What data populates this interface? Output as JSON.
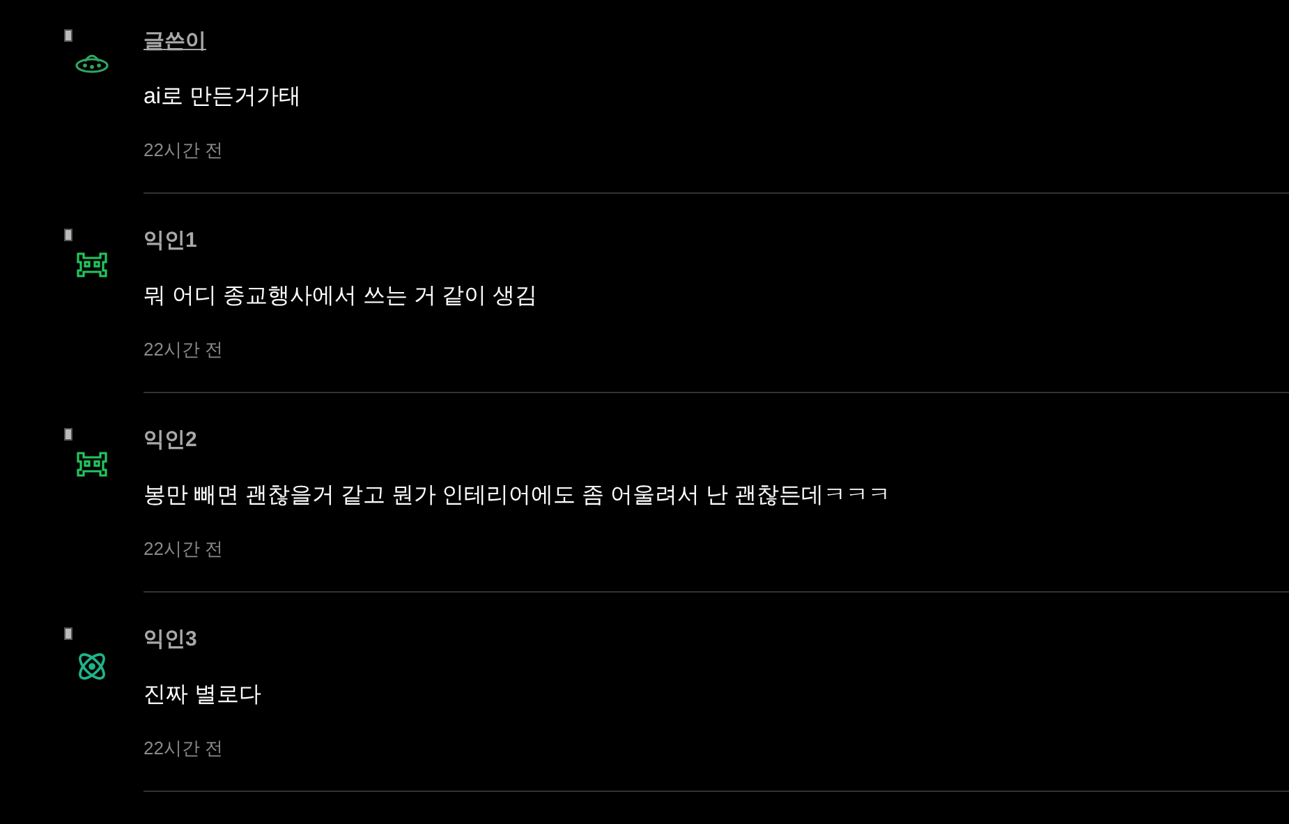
{
  "comments": [
    {
      "author": "글쓴이",
      "op": true,
      "avatar": {
        "kind": "ufo"
      },
      "body": "ai로 만든거가태",
      "time": "22시간 전"
    },
    {
      "author": "익인1",
      "op": false,
      "avatar": {
        "kind": "invader"
      },
      "body": "뭐 어디 종교행사에서 쓰는 거 같이 생김",
      "time": "22시간 전"
    },
    {
      "author": "익인2",
      "op": false,
      "avatar": {
        "kind": "invader"
      },
      "body": "봉만 빼면 괜찮을거 같고 뭔가 인테리어에도 좀 어울려서 난 괜찮든데ㅋㅋㅋ",
      "time": "22시간 전"
    },
    {
      "author": "익인3",
      "op": false,
      "avatar": {
        "kind": "atom"
      },
      "body": "진짜 별로다",
      "time": "22시간 전"
    }
  ]
}
